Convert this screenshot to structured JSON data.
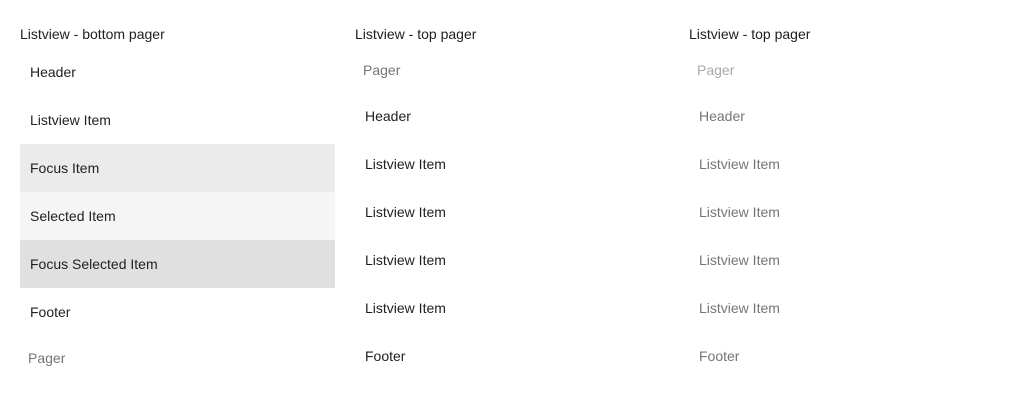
{
  "columns": [
    {
      "title": "Listview - bottom pager",
      "header": "Header",
      "items": [
        "Listview Item",
        "Focus Item",
        "Selected Item",
        "Focus Selected Item"
      ],
      "footer": "Footer",
      "pager": "Pager"
    },
    {
      "title": "Listview - top pager",
      "pager": "Pager",
      "header": "Header",
      "items": [
        "Listview Item",
        "Listview Item",
        "Listview Item",
        "Listview Item"
      ],
      "footer": "Footer"
    },
    {
      "title": "Listview - top pager",
      "pager": "Pager",
      "header": "Header",
      "items": [
        "Listview Item",
        "Listview Item",
        "Listview Item",
        "Listview Item"
      ],
      "footer": "Footer"
    }
  ],
  "colors": {
    "focus": "#ebebeb",
    "selected": "#f5f5f5",
    "focus_selected": "#e0e0e0",
    "disabled_text": "#757575",
    "text": "#212121"
  }
}
